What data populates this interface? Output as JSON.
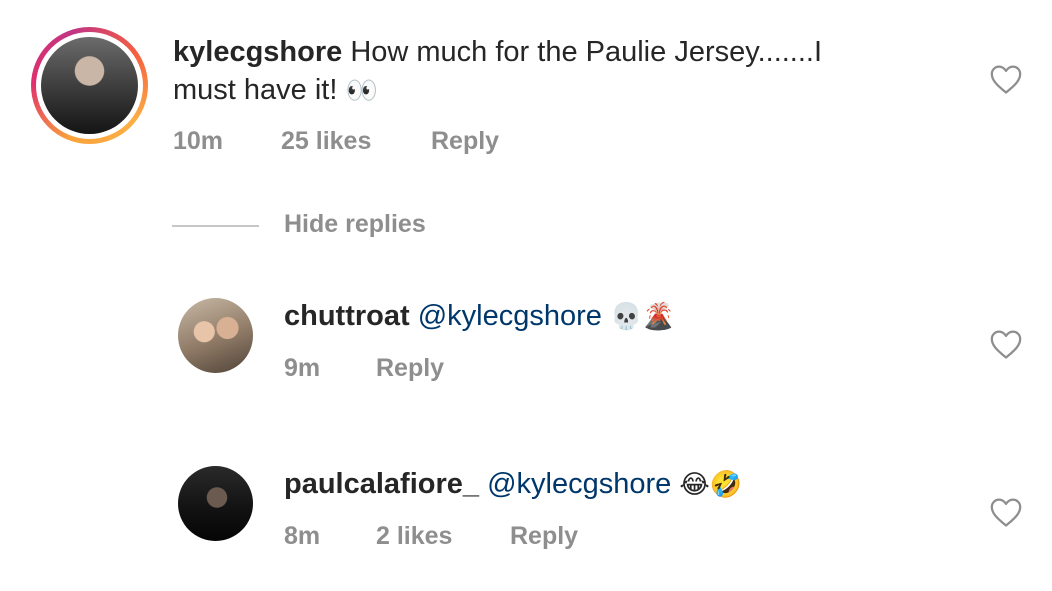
{
  "comments": [
    {
      "username": "kylecgshore",
      "text_line1": "How much for the Paulie Jersey.......I",
      "text_line2": "must have it!",
      "emoji": "👀",
      "time": "10m",
      "likes": "25 likes",
      "reply_label": "Reply",
      "avatar_icon": "profile-photo-kylecgshore"
    }
  ],
  "hide_replies_label": "Hide replies",
  "replies": [
    {
      "username": "chuttroat",
      "mention": "@kylecgshore",
      "emoji": "💀🌋",
      "time": "9m",
      "reply_label": "Reply",
      "avatar_icon": "profile-photo-chuttroat"
    },
    {
      "username": "paulcalafiore_",
      "mention": "@kylecgshore",
      "emoji": "😂🤣",
      "time": "8m",
      "likes": "2 likes",
      "reply_label": "Reply",
      "avatar_icon": "profile-photo-paulcalafiore"
    }
  ],
  "colors": {
    "mention": "#00376b",
    "meta": "#8e8e8e",
    "text": "#262626",
    "story_ring": [
      "#f9a23b",
      "#e1306c",
      "#c13584"
    ]
  },
  "icons": {
    "like": "heart-outline-icon"
  }
}
